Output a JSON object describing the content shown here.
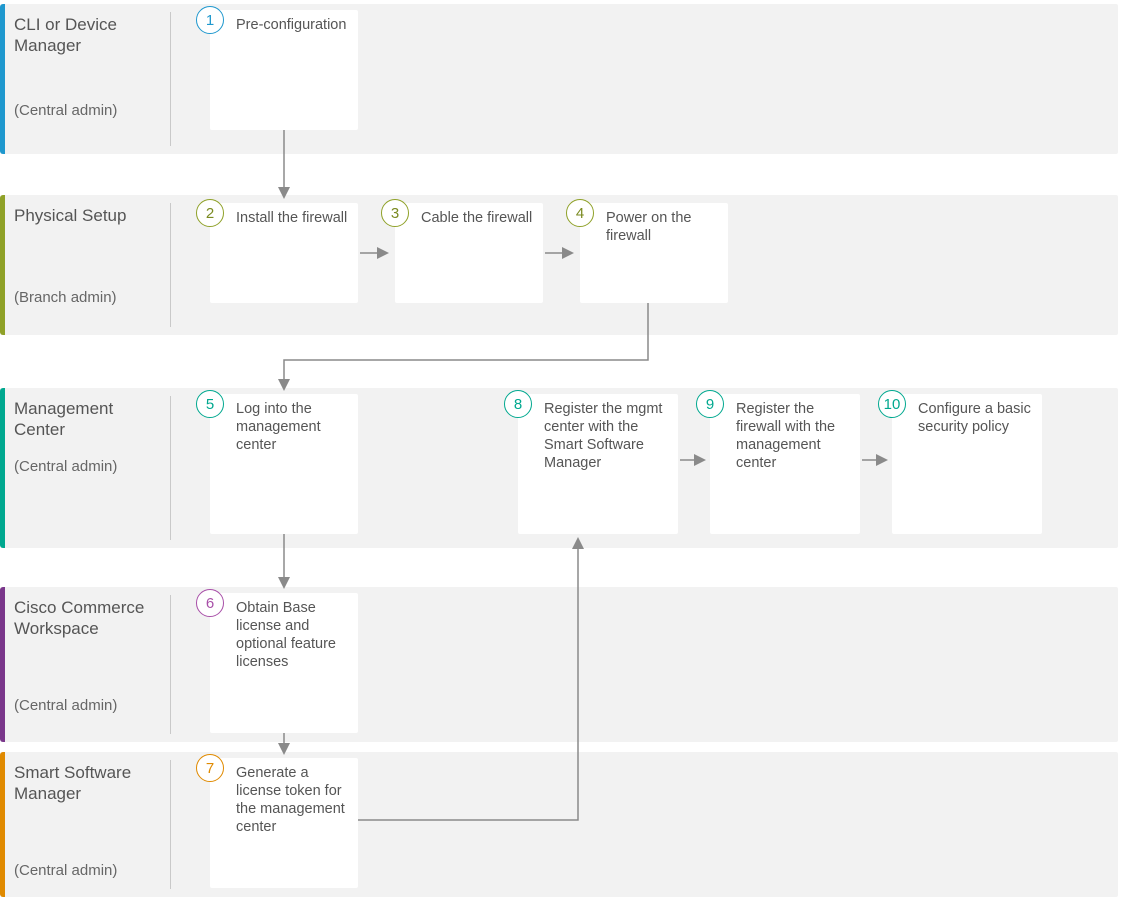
{
  "lanes": [
    {
      "title": "CLI or Device Manager",
      "sub": "(Central admin)",
      "color": "#1f98ce"
    },
    {
      "title": "Physical Setup",
      "sub": "(Branch admin)",
      "color": "#8fa128"
    },
    {
      "title": "Management Center",
      "sub": "(Central admin)",
      "color": "#00a88f"
    },
    {
      "title": "Cisco Commerce Workspace",
      "sub": "(Central admin)",
      "color": "#7a378b"
    },
    {
      "title": "Smart Software Manager",
      "sub": "(Central admin)",
      "color": "#e08a00"
    }
  ],
  "steps": {
    "s1": {
      "num": "1",
      "text": "Pre-configura­tion",
      "badgeColor": "#1f98ce"
    },
    "s2": {
      "num": "2",
      "text": "Install the firewall",
      "badgeColor": "#8fa128"
    },
    "s3": {
      "num": "3",
      "text": "Cable the firewall",
      "badgeColor": "#8fa128"
    },
    "s4": {
      "num": "4",
      "text": "Power on the firewall",
      "badgeColor": "#8fa128"
    },
    "s5": {
      "num": "5",
      "text": "Log into the management center",
      "badgeColor": "#00a88f"
    },
    "s8": {
      "num": "8",
      "text": "Register the mgmt center with the Smart Software Manager",
      "badgeColor": "#00a88f"
    },
    "s9": {
      "num": "9",
      "text": "Register the firewall with the manage­ment center",
      "badgeColor": "#00a88f"
    },
    "s10": {
      "num": "10",
      "text": "Configure a basic security policy",
      "badgeColor": "#00a88f"
    },
    "s6": {
      "num": "6",
      "text": "Obtain Base license and optional feature licenses",
      "badgeColor": "#a84fa8"
    },
    "s7": {
      "num": "7",
      "text": "Generate a license token for the management center",
      "badgeColor": "#e08a00"
    }
  }
}
